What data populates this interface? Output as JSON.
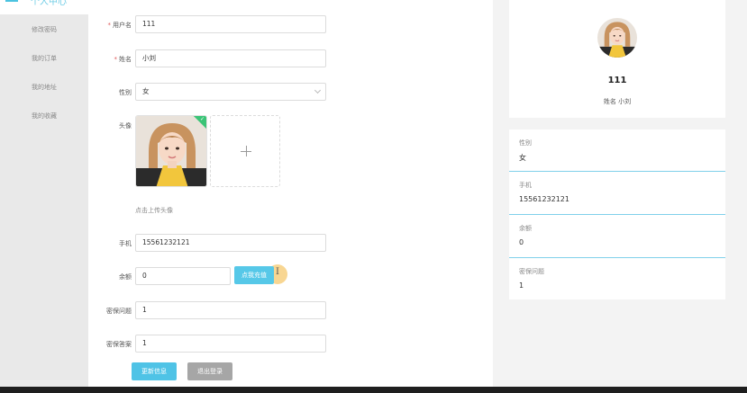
{
  "sidebar": {
    "active_label": "个人中心",
    "items": [
      {
        "label": "修改密码"
      },
      {
        "label": "我的订单"
      },
      {
        "label": "我的地址"
      },
      {
        "label": "我的收藏"
      }
    ]
  },
  "form": {
    "username": {
      "label": "用户名",
      "required": "*",
      "value": "111"
    },
    "name": {
      "label": "姓名",
      "required": "*",
      "value": "小刘"
    },
    "gender": {
      "label": "性别",
      "value": "女"
    },
    "avatar": {
      "label": "头像",
      "hint": "点击上传头像"
    },
    "phone": {
      "label": "手机",
      "value": "15561232121"
    },
    "balance": {
      "label": "余额",
      "value": "0",
      "recharge_button": "点我充值"
    },
    "security_question": {
      "label": "密保问题",
      "value": "1"
    },
    "security_answer": {
      "label": "密保答案",
      "value": "1"
    },
    "update_button": "更新信息",
    "logout_button": "退出登录"
  },
  "profile": {
    "name": "111",
    "subtitle": "姓名 小刘",
    "info": [
      {
        "label": "性别",
        "value": "女"
      },
      {
        "label": "手机",
        "value": "15561232121"
      },
      {
        "label": "余额",
        "value": "0"
      },
      {
        "label": "密保问题",
        "value": "1"
      }
    ]
  },
  "colors": {
    "accent": "#4fc3e6",
    "required": "#e05b5b",
    "upload_success": "#3bc477",
    "logout": "#a6a6a6"
  }
}
